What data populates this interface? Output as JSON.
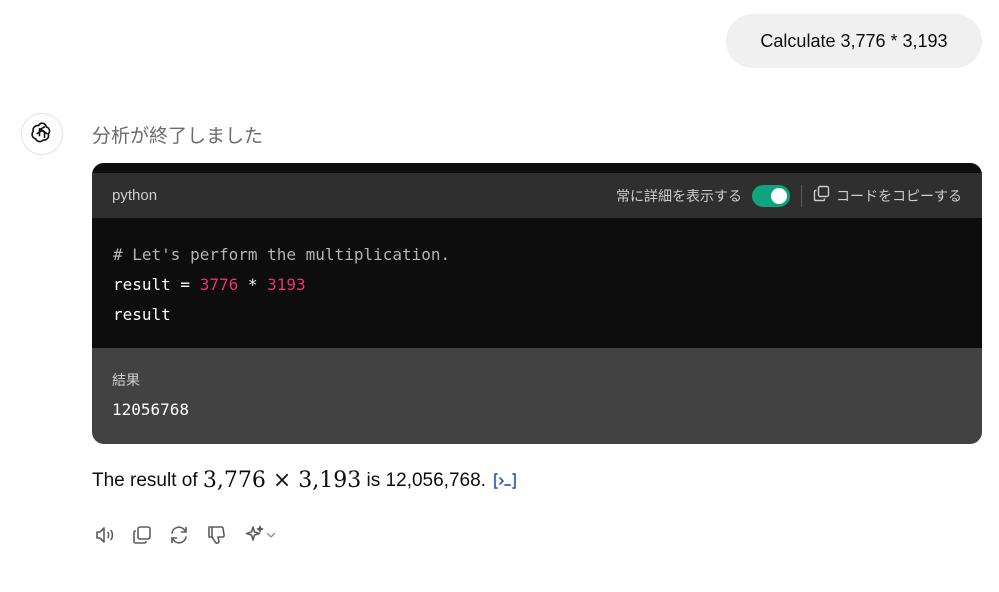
{
  "user_message": "Calculate 3,776 * 3,193",
  "assistant": {
    "status": "分析が終了しました",
    "code_block": {
      "language": "python",
      "toggle_label": "常に詳細を表示する",
      "toggle_on": true,
      "copy_label": "コードをコピーする",
      "lines": [
        {
          "comment": "# Let's perform the multiplication."
        },
        {
          "var": "result",
          "op1": " = ",
          "num1": "3776",
          "op2": " * ",
          "num2": "3193"
        },
        {
          "plain": "result"
        }
      ],
      "result_label": "結果",
      "result_value": "12056768"
    },
    "answer": {
      "prefix": "The result of ",
      "math": "3,776 × 3,193",
      "suffix": " is 12,056,768."
    }
  },
  "colors": {
    "accent_toggle": "#10a37f",
    "number_literal": "#e8336f",
    "source_icon": "#2d5fb0"
  },
  "icons": [
    "openai-logo-icon",
    "copy-icon",
    "source-code-icon",
    "speaker-icon",
    "copy-icon",
    "regenerate-icon",
    "thumbs-down-icon",
    "sparkle-icon",
    "chevron-down-icon"
  ]
}
